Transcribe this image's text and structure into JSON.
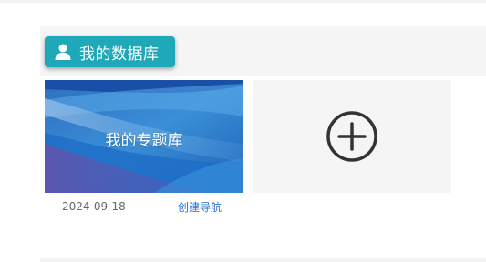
{
  "header": {
    "title": "我的数据库",
    "icon": "user-icon",
    "badge_color": "#1ea8b8"
  },
  "cards": [
    {
      "title": "我的专题库",
      "date": "2024-09-18",
      "action_label": "创建导航",
      "action_color": "#2a74d0"
    }
  ],
  "add_card": {
    "icon": "plus-circle-icon"
  }
}
